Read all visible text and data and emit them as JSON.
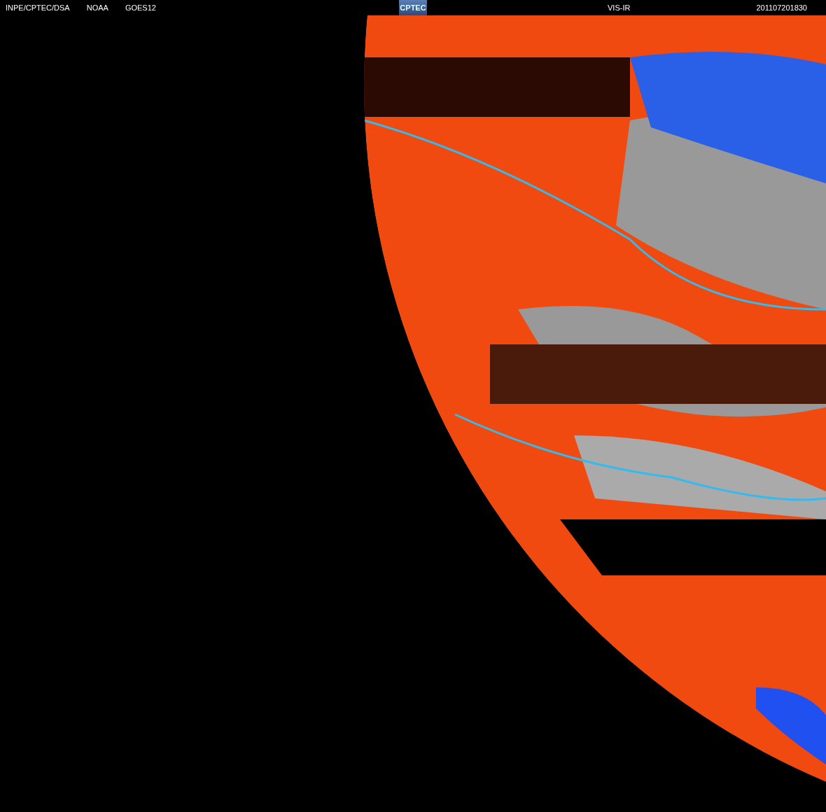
{
  "header": {
    "left_labels": [
      "INPE/CPTEC/DSA",
      "NOAA",
      "GOES12"
    ],
    "logo": "CPTEC",
    "channel": "VIS-IR",
    "timestamp": "201107201830"
  }
}
